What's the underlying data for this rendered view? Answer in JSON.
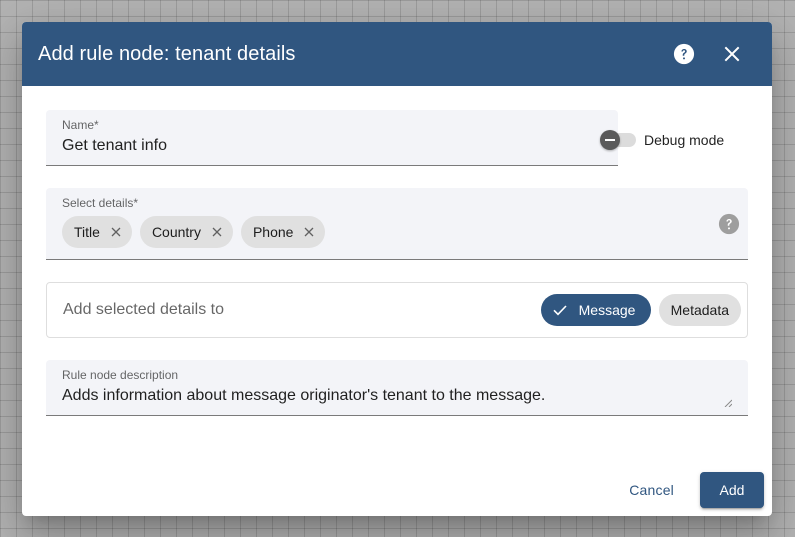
{
  "dialog": {
    "title": "Add rule node: tenant details",
    "help_icon": "help-circle-icon",
    "close_icon": "close-icon"
  },
  "name_field": {
    "label": "Name*",
    "value": "Get tenant info"
  },
  "debug_mode": {
    "label": "Debug mode",
    "enabled": false
  },
  "select_details": {
    "label": "Select details*",
    "chips": [
      {
        "label": "Title"
      },
      {
        "label": "Country"
      },
      {
        "label": "Phone"
      }
    ]
  },
  "add_details_to": {
    "label": "Add selected details to",
    "options": [
      {
        "label": "Message",
        "selected": true
      },
      {
        "label": "Metadata",
        "selected": false
      }
    ]
  },
  "description_field": {
    "label": "Rule node description",
    "value": "Adds information about message originator's tenant to the message."
  },
  "actions": {
    "cancel_label": "Cancel",
    "add_label": "Add"
  },
  "colors": {
    "primary": "#305680",
    "field_bg": "#f3f4f8",
    "chip_bg": "#e0e0e0"
  }
}
